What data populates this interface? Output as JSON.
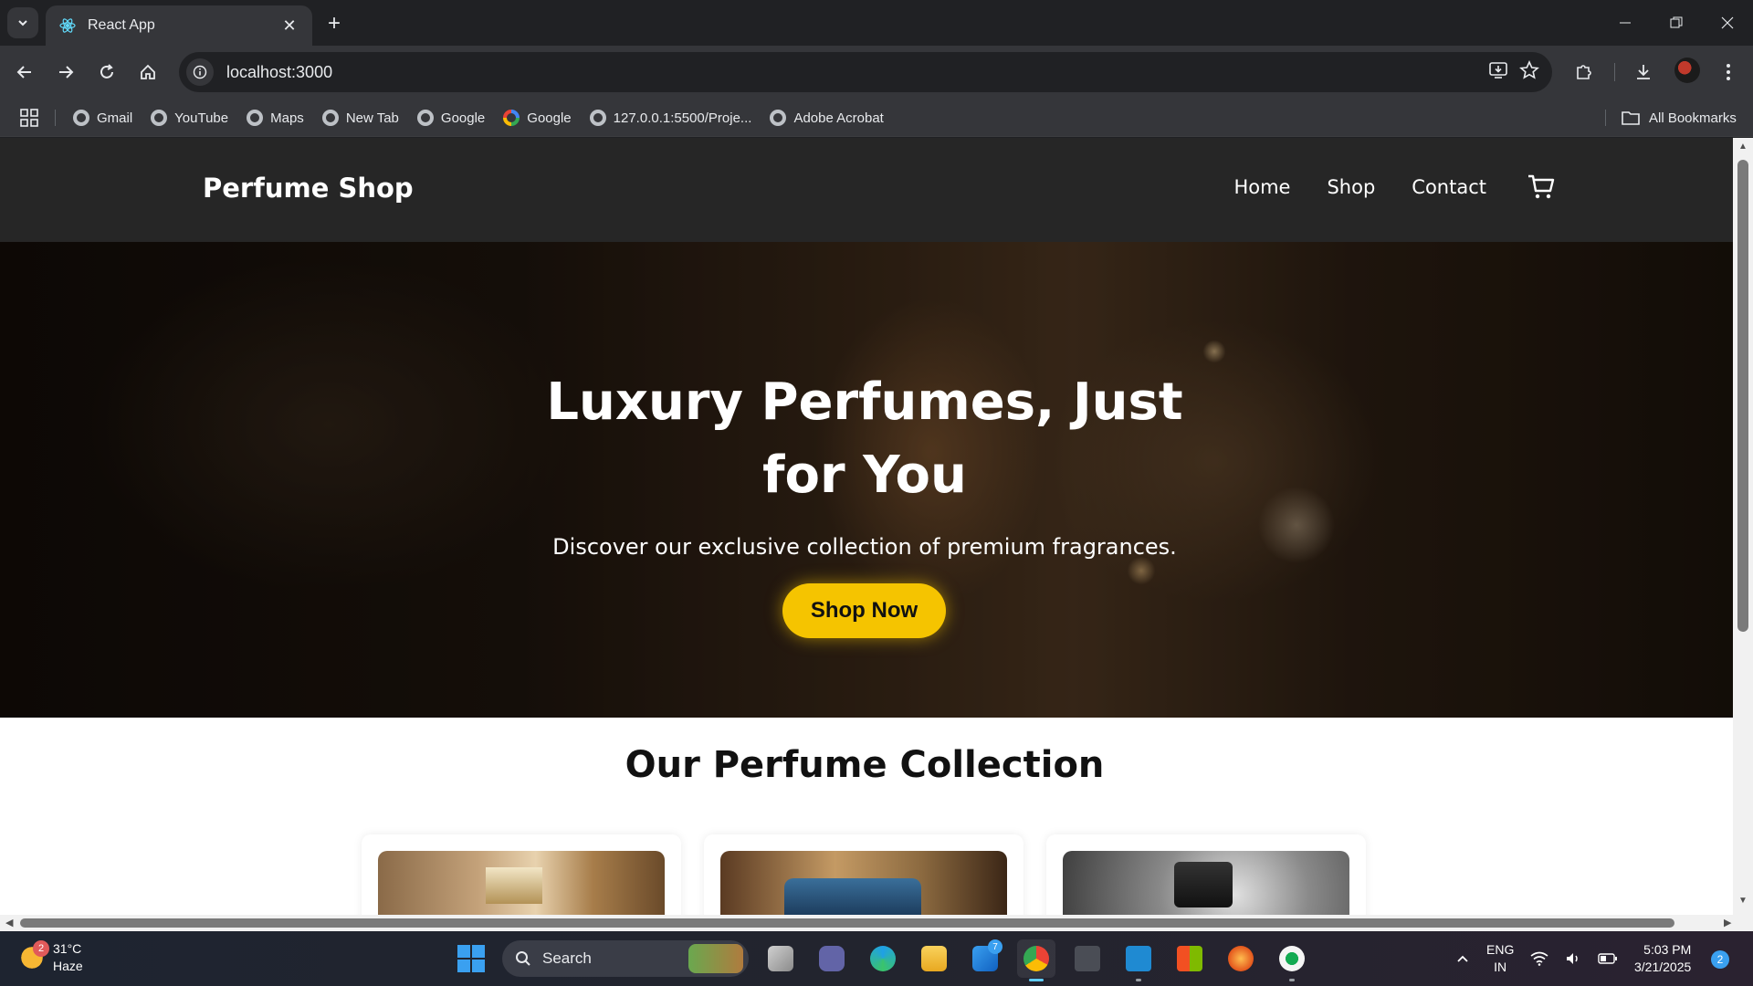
{
  "browser": {
    "tab_title": "React App",
    "url": "localhost:3000",
    "bookmarks": [
      {
        "label": "Gmail",
        "icon": "globe-icon"
      },
      {
        "label": "YouTube",
        "icon": "globe-icon"
      },
      {
        "label": "Maps",
        "icon": "globe-icon"
      },
      {
        "label": "New Tab",
        "icon": "globe-icon"
      },
      {
        "label": "Google",
        "icon": "globe-icon"
      },
      {
        "label": "Google",
        "icon": "google-icon"
      },
      {
        "label": "127.0.0.1:5500/Proje...",
        "icon": "globe-icon"
      },
      {
        "label": "Adobe Acrobat",
        "icon": "globe-icon"
      }
    ],
    "all_bookmarks": "All Bookmarks"
  },
  "site": {
    "brand": "Perfume Shop",
    "nav": [
      "Home",
      "Shop",
      "Contact"
    ],
    "hero_title": "Luxury Perfumes, Just for You",
    "hero_subtitle": "Discover our exclusive collection of premium fragrances.",
    "hero_button": "Shop Now",
    "collection_title": "Our Perfume Collection",
    "accent_color": "#f5c400",
    "header_color": "#262626"
  },
  "taskbar": {
    "temperature": "31°C",
    "weather": "Haze",
    "weather_badge": "2",
    "search_label": "Search",
    "mail_badge": "7",
    "lang_top": "ENG",
    "lang_bottom": "IN",
    "time": "5:03 PM",
    "date": "3/21/2025",
    "notifications": "2"
  }
}
